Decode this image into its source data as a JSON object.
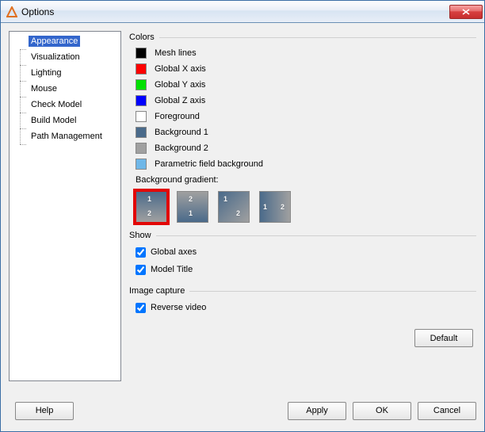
{
  "window": {
    "title": "Options"
  },
  "tree": {
    "items": [
      {
        "label": "Appearance",
        "selected": true
      },
      {
        "label": "Visualization",
        "selected": false
      },
      {
        "label": "Lighting",
        "selected": false
      },
      {
        "label": "Mouse",
        "selected": false
      },
      {
        "label": "Check Model",
        "selected": false
      },
      {
        "label": "Build Model",
        "selected": false
      },
      {
        "label": "Path Management",
        "selected": false
      }
    ]
  },
  "colors": {
    "title": "Colors",
    "items": [
      {
        "label": "Mesh lines",
        "swatch": "#000000"
      },
      {
        "label": "Global X axis",
        "swatch": "#ff0000"
      },
      {
        "label": "Global Y axis",
        "swatch": "#00e000"
      },
      {
        "label": "Global Z axis",
        "swatch": "#0000ff"
      },
      {
        "label": "Foreground",
        "swatch": "#ffffff"
      },
      {
        "label": "Background 1",
        "swatch": "#4a6a8a"
      },
      {
        "label": "Background 2",
        "swatch": "#a0a0a0"
      },
      {
        "label": "Parametric field background",
        "swatch": "#6fb7e8"
      }
    ],
    "gradient_label": "Background gradient:",
    "gradients": [
      {
        "type": "vertical",
        "selected": true
      },
      {
        "type": "vertical-rev",
        "selected": false
      },
      {
        "type": "diagonal",
        "selected": false
      },
      {
        "type": "horizontal",
        "selected": false
      }
    ]
  },
  "show": {
    "title": "Show",
    "items": [
      {
        "label": "Global axes",
        "checked": true
      },
      {
        "label": "Model Title",
        "checked": true
      }
    ]
  },
  "capture": {
    "title": "Image capture",
    "items": [
      {
        "label": "Reverse video",
        "checked": true
      }
    ]
  },
  "buttons": {
    "default": "Default",
    "help": "Help",
    "apply": "Apply",
    "ok": "OK",
    "cancel": "Cancel"
  }
}
